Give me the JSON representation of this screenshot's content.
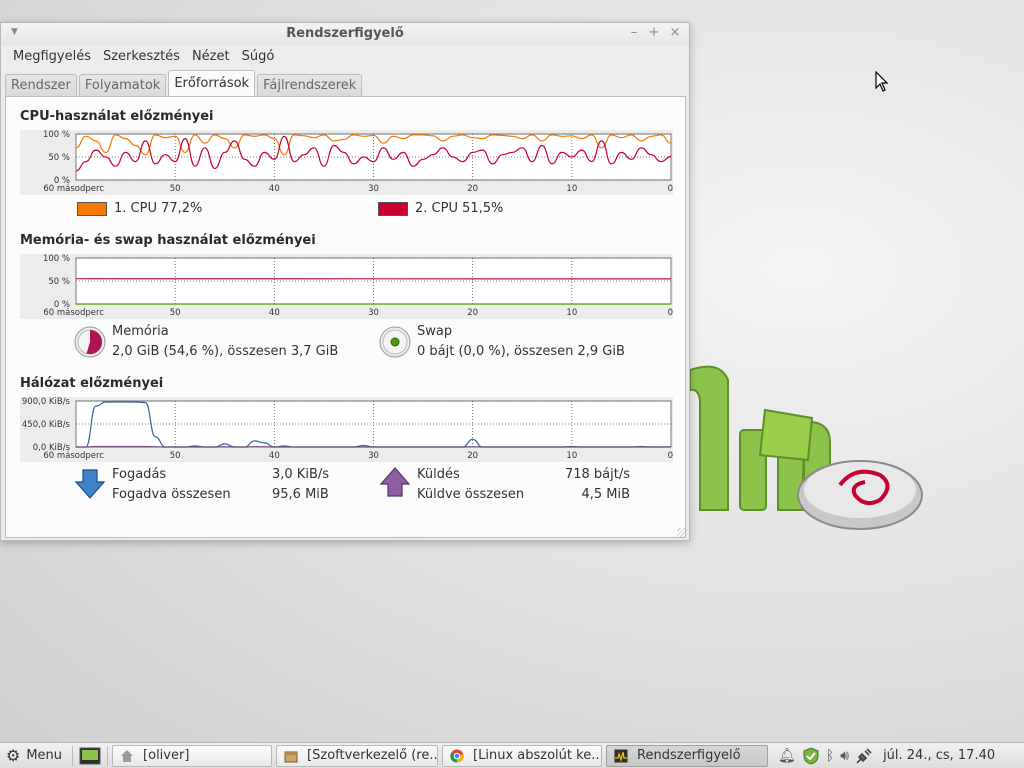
{
  "window": {
    "title": "Rendszerfigyelő",
    "menu": [
      "Megfigyelés",
      "Szerkesztés",
      "Nézet",
      "Súgó"
    ],
    "tabs": [
      {
        "label": "Rendszer",
        "active": false
      },
      {
        "label": "Folyamatok",
        "active": false
      },
      {
        "label": "Erőforrások",
        "active": true
      },
      {
        "label": "Fájlrendszerek",
        "active": false
      }
    ]
  },
  "cpu": {
    "title": "CPU-használat előzményei",
    "y_ticks": [
      "100 %",
      "50 %",
      "0 %"
    ],
    "x_ticks": [
      "60 másodperc",
      "50",
      "40",
      "30",
      "20",
      "10",
      "0"
    ],
    "legend": [
      {
        "label": "1. CPU",
        "value": "77,2%",
        "color": "#f57900"
      },
      {
        "label": "2. CPU",
        "value": "51,5%",
        "color": "#c7002f"
      }
    ]
  },
  "memory": {
    "title": "Memória- és swap használat előzményei",
    "y_ticks": [
      "100 %",
      "50 %",
      "0 %"
    ],
    "x_ticks": [
      "60 másodperc",
      "50",
      "40",
      "30",
      "20",
      "10",
      "0"
    ],
    "mem_label": "Memória",
    "mem_value": "2,0 GiB (54,6 %), összesen 3,7 GiB",
    "swap_label": "Swap",
    "swap_value": "0 bájt (0,0 %), összesen 2,9 GiB",
    "mem_percent": 54.6,
    "swap_percent": 0.0,
    "mem_color": "#ad1457",
    "swap_color": "#4e9a06"
  },
  "network": {
    "title": "Hálózat előzményei",
    "y_ticks": [
      "900,0 KiB/s",
      "450,0 KiB/s",
      "0,0 KiB/s"
    ],
    "x_ticks": [
      "60 másodperc",
      "50",
      "40",
      "30",
      "20",
      "10",
      "0"
    ],
    "recv_label": "Fogadás",
    "recv_value": "3,0 KiB/s",
    "recv_total_label": "Fogadva összesen",
    "recv_total_value": "95,6 MiB",
    "send_label": "Küldés",
    "send_value": "718 bájt/s",
    "send_total_label": "Küldve összesen",
    "send_total_value": "4,5 MiB",
    "recv_color": "#3465a4",
    "send_color": "#75507b"
  },
  "chart_data": [
    {
      "type": "line",
      "title": "CPU-használat előzményei",
      "ylim": [
        0,
        100
      ],
      "xlim": [
        60,
        0
      ],
      "series": [
        {
          "name": "1. CPU",
          "values": [
            70,
            95,
            85,
            60,
            98,
            90,
            75,
            55,
            98,
            92,
            95,
            60,
            98,
            80,
            98,
            90,
            70,
            98,
            95,
            98,
            90,
            55,
            98,
            96,
            92,
            98,
            85,
            88,
            98,
            95,
            97,
            80,
            95,
            90,
            98,
            98,
            96,
            85,
            95,
            98,
            92,
            90,
            98,
            97,
            95,
            90,
            98,
            85,
            98,
            95,
            96,
            90,
            98,
            70,
            98,
            92,
            98,
            85,
            95,
            98,
            80
          ]
        },
        {
          "name": "2. CPU",
          "values": [
            20,
            40,
            65,
            50,
            30,
            60,
            40,
            85,
            35,
            55,
            40,
            90,
            30,
            70,
            25,
            60,
            85,
            45,
            30,
            60,
            45,
            95,
            40,
            55,
            70,
            30,
            75,
            60,
            35,
            50,
            40,
            70,
            45,
            60,
            30,
            45,
            55,
            70,
            50,
            40,
            60,
            65,
            35,
            55,
            60,
            70,
            40,
            75,
            35,
            60,
            50,
            65,
            40,
            85,
            35,
            60,
            45,
            70,
            55,
            40,
            51
          ]
        }
      ]
    },
    {
      "type": "line",
      "title": "Memória- és swap használat előzményei",
      "ylim": [
        0,
        100
      ],
      "xlim": [
        60,
        0
      ],
      "series": [
        {
          "name": "Memória",
          "values": [
            55,
            54.6
          ]
        },
        {
          "name": "Swap",
          "values": [
            0,
            0
          ]
        }
      ]
    },
    {
      "type": "line",
      "title": "Hálózat előzményei",
      "ylim": [
        0,
        900
      ],
      "xlim": [
        60,
        0
      ],
      "series": [
        {
          "name": "Fogadás",
          "values": [
            0,
            0,
            800,
            880,
            880,
            880,
            880,
            870,
            200,
            0,
            0,
            0,
            20,
            0,
            0,
            60,
            0,
            0,
            120,
            80,
            0,
            20,
            0,
            0,
            0,
            0,
            0,
            0,
            0,
            30,
            0,
            0,
            0,
            0,
            0,
            0,
            0,
            0,
            0,
            0,
            150,
            0,
            0,
            0,
            0,
            0,
            0,
            0,
            0,
            0,
            10,
            0,
            0,
            0,
            0,
            0,
            0,
            10,
            0,
            0,
            3
          ]
        },
        {
          "name": "Küldés",
          "values": [
            0,
            0,
            10,
            10,
            10,
            10,
            10,
            10,
            5,
            0,
            0,
            0,
            0,
            0,
            0,
            5,
            0,
            0,
            5,
            5,
            0,
            0,
            0,
            0,
            0,
            0,
            0,
            0,
            0,
            0,
            0,
            0,
            0,
            0,
            0,
            0,
            0,
            0,
            0,
            0,
            5,
            0,
            0,
            0,
            0,
            0,
            0,
            0,
            0,
            0,
            0,
            0,
            0,
            0,
            0,
            0,
            0,
            0,
            0,
            0,
            0.7
          ]
        }
      ]
    }
  ],
  "taskbar": {
    "menu_label": "Menu",
    "tasks": [
      {
        "label": "[oliver]",
        "icon": "home-icon"
      },
      {
        "label": "[Szoftverkezelő (re...",
        "icon": "package-icon"
      },
      {
        "label": "[Linux abszolút ke...",
        "icon": "chrome-icon"
      },
      {
        "label": "Rendszerfigyelő",
        "icon": "system-monitor-icon",
        "active": true
      }
    ],
    "clock": "júl. 24., cs, 17.40"
  }
}
